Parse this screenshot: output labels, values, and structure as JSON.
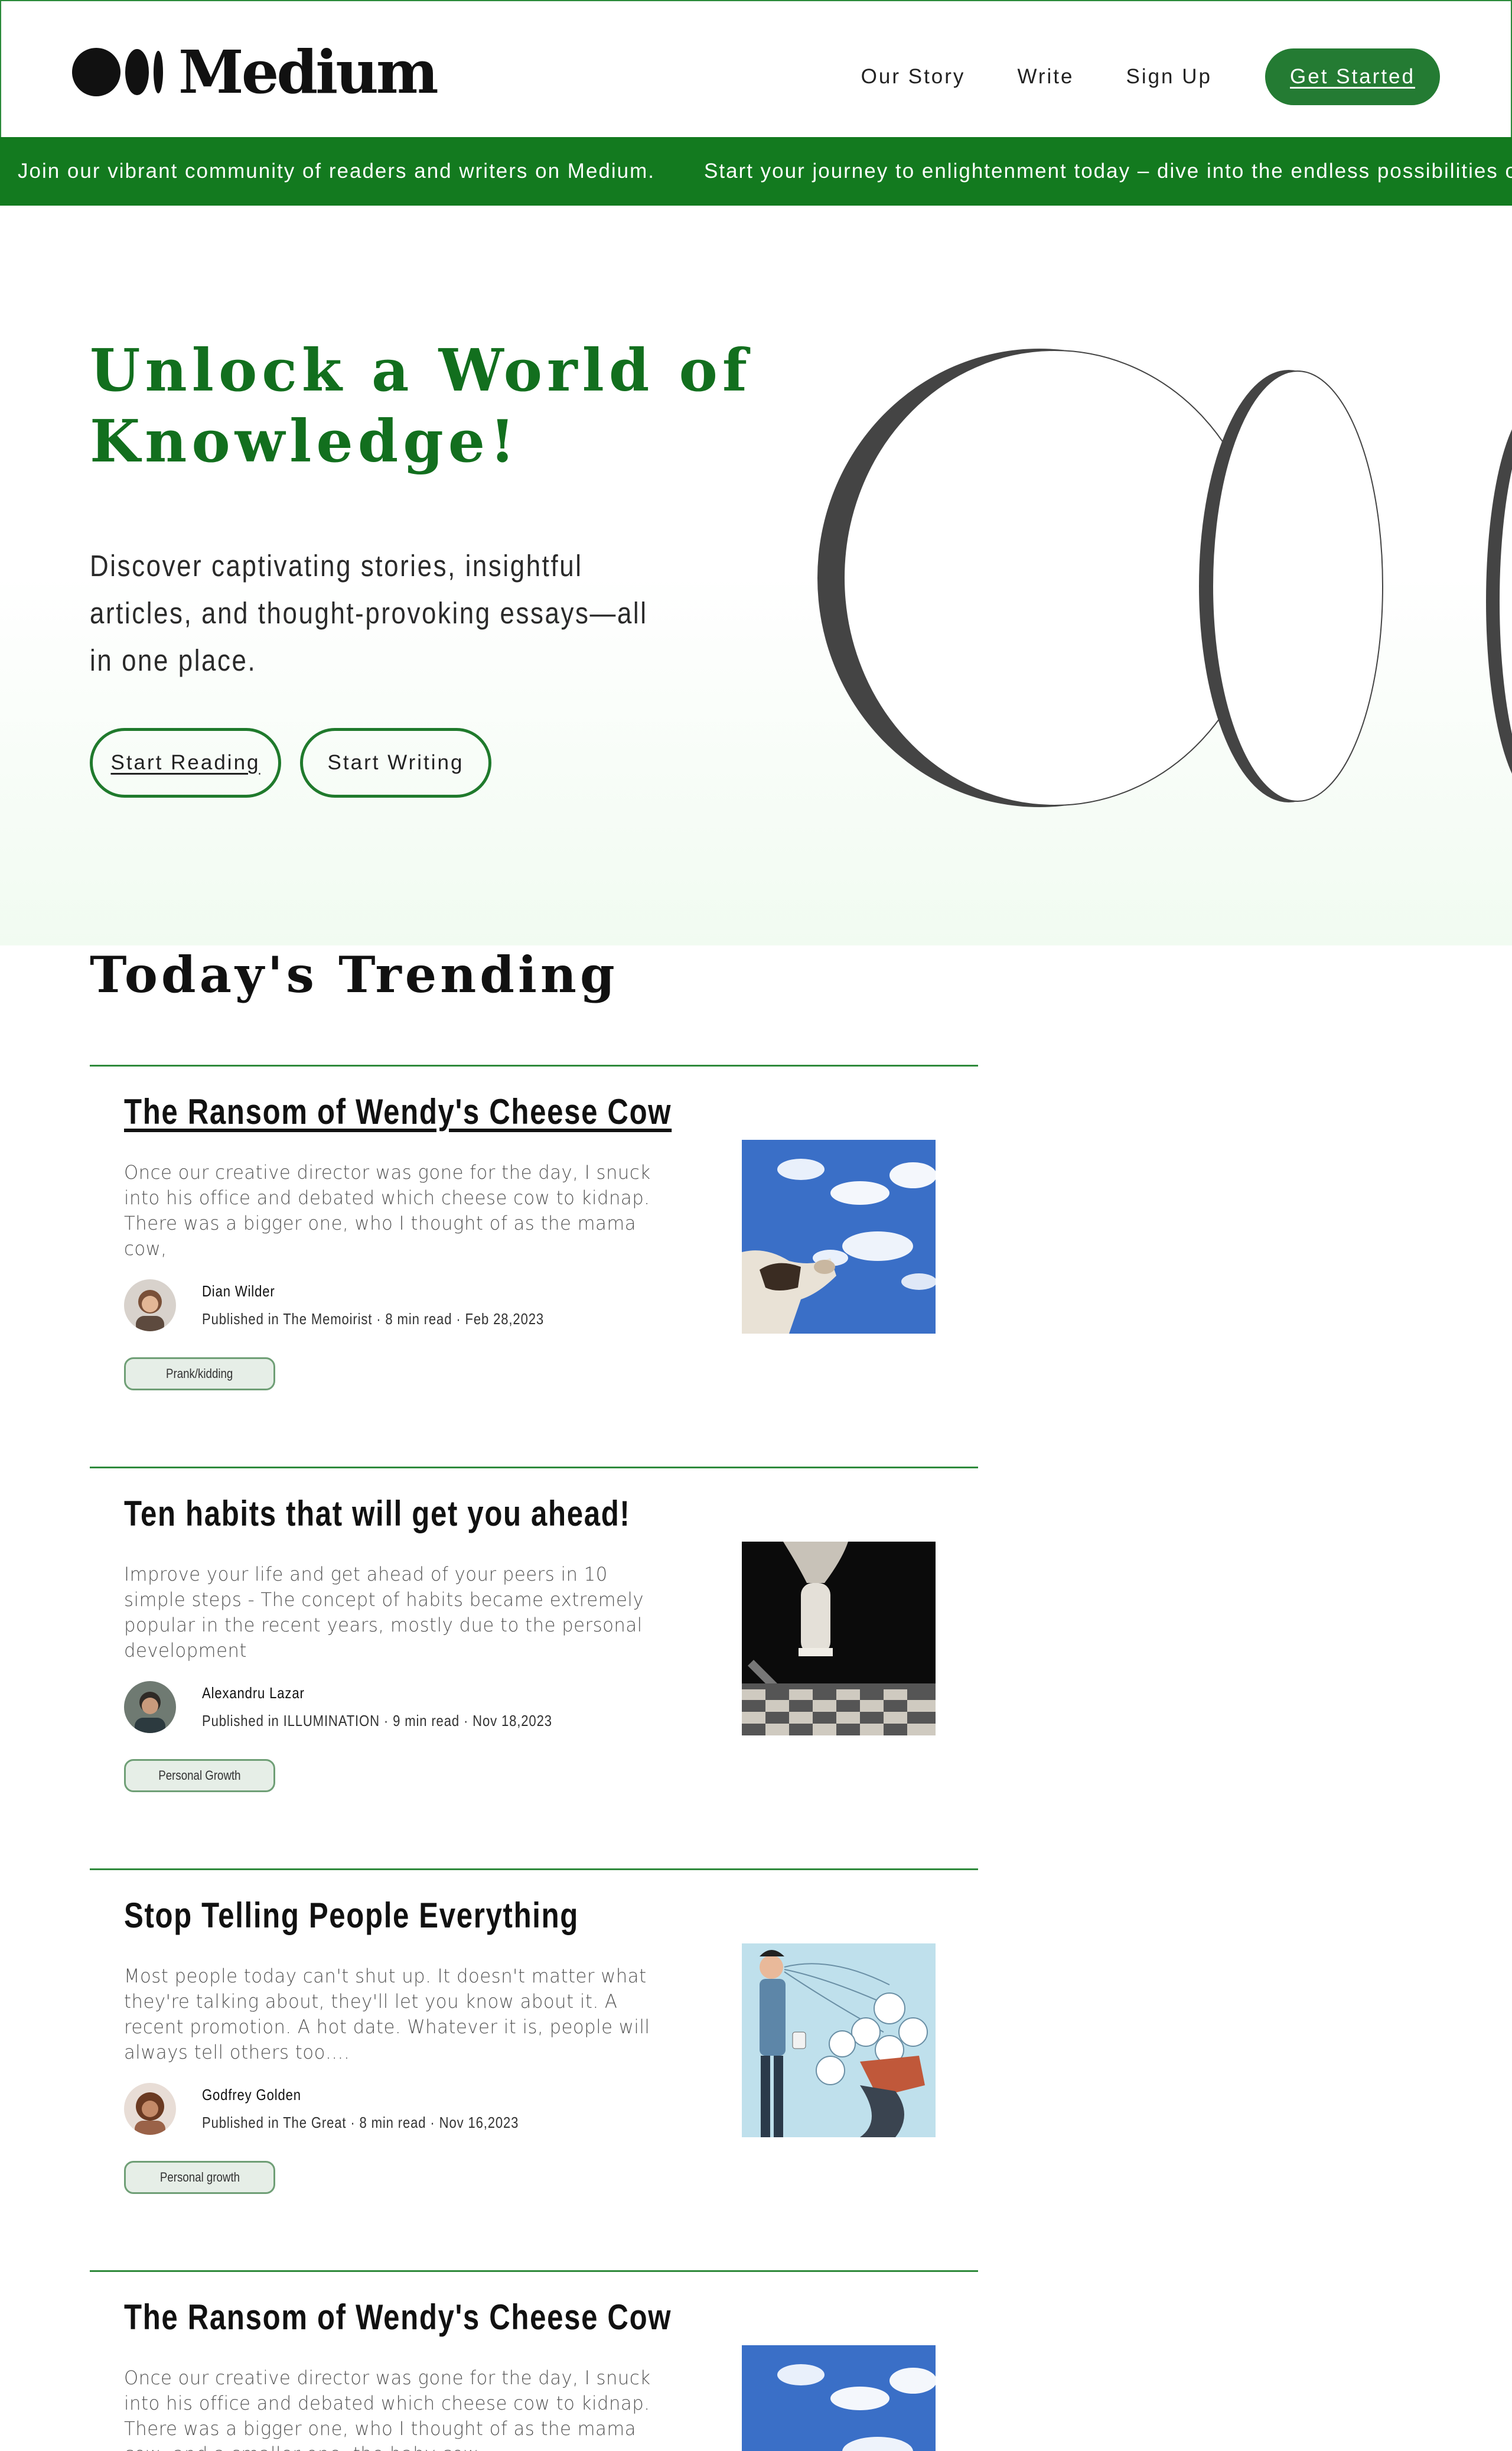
{
  "header": {
    "logo_text": "Medium",
    "nav": [
      "Our Story",
      "Write",
      "Sign Up"
    ],
    "cta": "Get Started"
  },
  "ticker": [
    "Join our vibrant community of readers and writers on Medium.",
    "Start your journey to enlightenment today – dive into the endless possibilities of"
  ],
  "hero": {
    "title": "Unlock a World of Knowledge!",
    "subtitle": "Discover captivating stories, insightful articles, and thought-provoking essays—all in one place.",
    "buttons": [
      "Start Reading",
      "Start Writing"
    ]
  },
  "trending": {
    "title": "Today's Trending",
    "articles": [
      {
        "title": "The Ransom of Wendy's Cheese Cow",
        "excerpt": "Once our creative director was gone for the day, I snuck into his office and debated which cheese cow to kidnap. There was a bigger one, who I thought of as the mama cow,",
        "author": "Dian Wilder",
        "meta": "Published in The Memoirist · 8 min read · Feb 28,2023",
        "tag": "Prank/kidding",
        "image": "cow-sky-image"
      },
      {
        "title": "Ten habits that will get you ahead!",
        "excerpt": "Improve your life and get ahead of your peers in 10 simple steps - The concept of habits became extremely popular in the recent years, mostly due to the personal development",
        "author": "Alexandru Lazar",
        "meta": "Published in ILLUMINATION · 9 min read · Nov 18,2023",
        "tag": "Personal Growth",
        "image": "chess-image"
      },
      {
        "title": "Stop Telling People Everything",
        "excerpt": "Most people today can't shut up. It doesn't matter what they're talking about, they'll let you know about it. A recent promotion. A hot date. Whatever it is, people will always tell others too….",
        "author": "Godfrey Golden",
        "meta": "Published in The Great · 8 min read · Nov 16,2023",
        "tag": "Personal growth",
        "image": "speech-bubbles-illustration"
      },
      {
        "title": "The Ransom of Wendy's Cheese Cow",
        "excerpt": "Once our creative director was gone for the day, I snuck into his office and debated which cheese cow to kidnap. There was a bigger one, who I thought of as the mama cow, and a smaller one, the baby cow",
        "image": "cow-sky-image"
      }
    ]
  },
  "colors": {
    "brand_green": "#137a1f",
    "title_green": "#126f1e",
    "button_green": "#247b33"
  }
}
